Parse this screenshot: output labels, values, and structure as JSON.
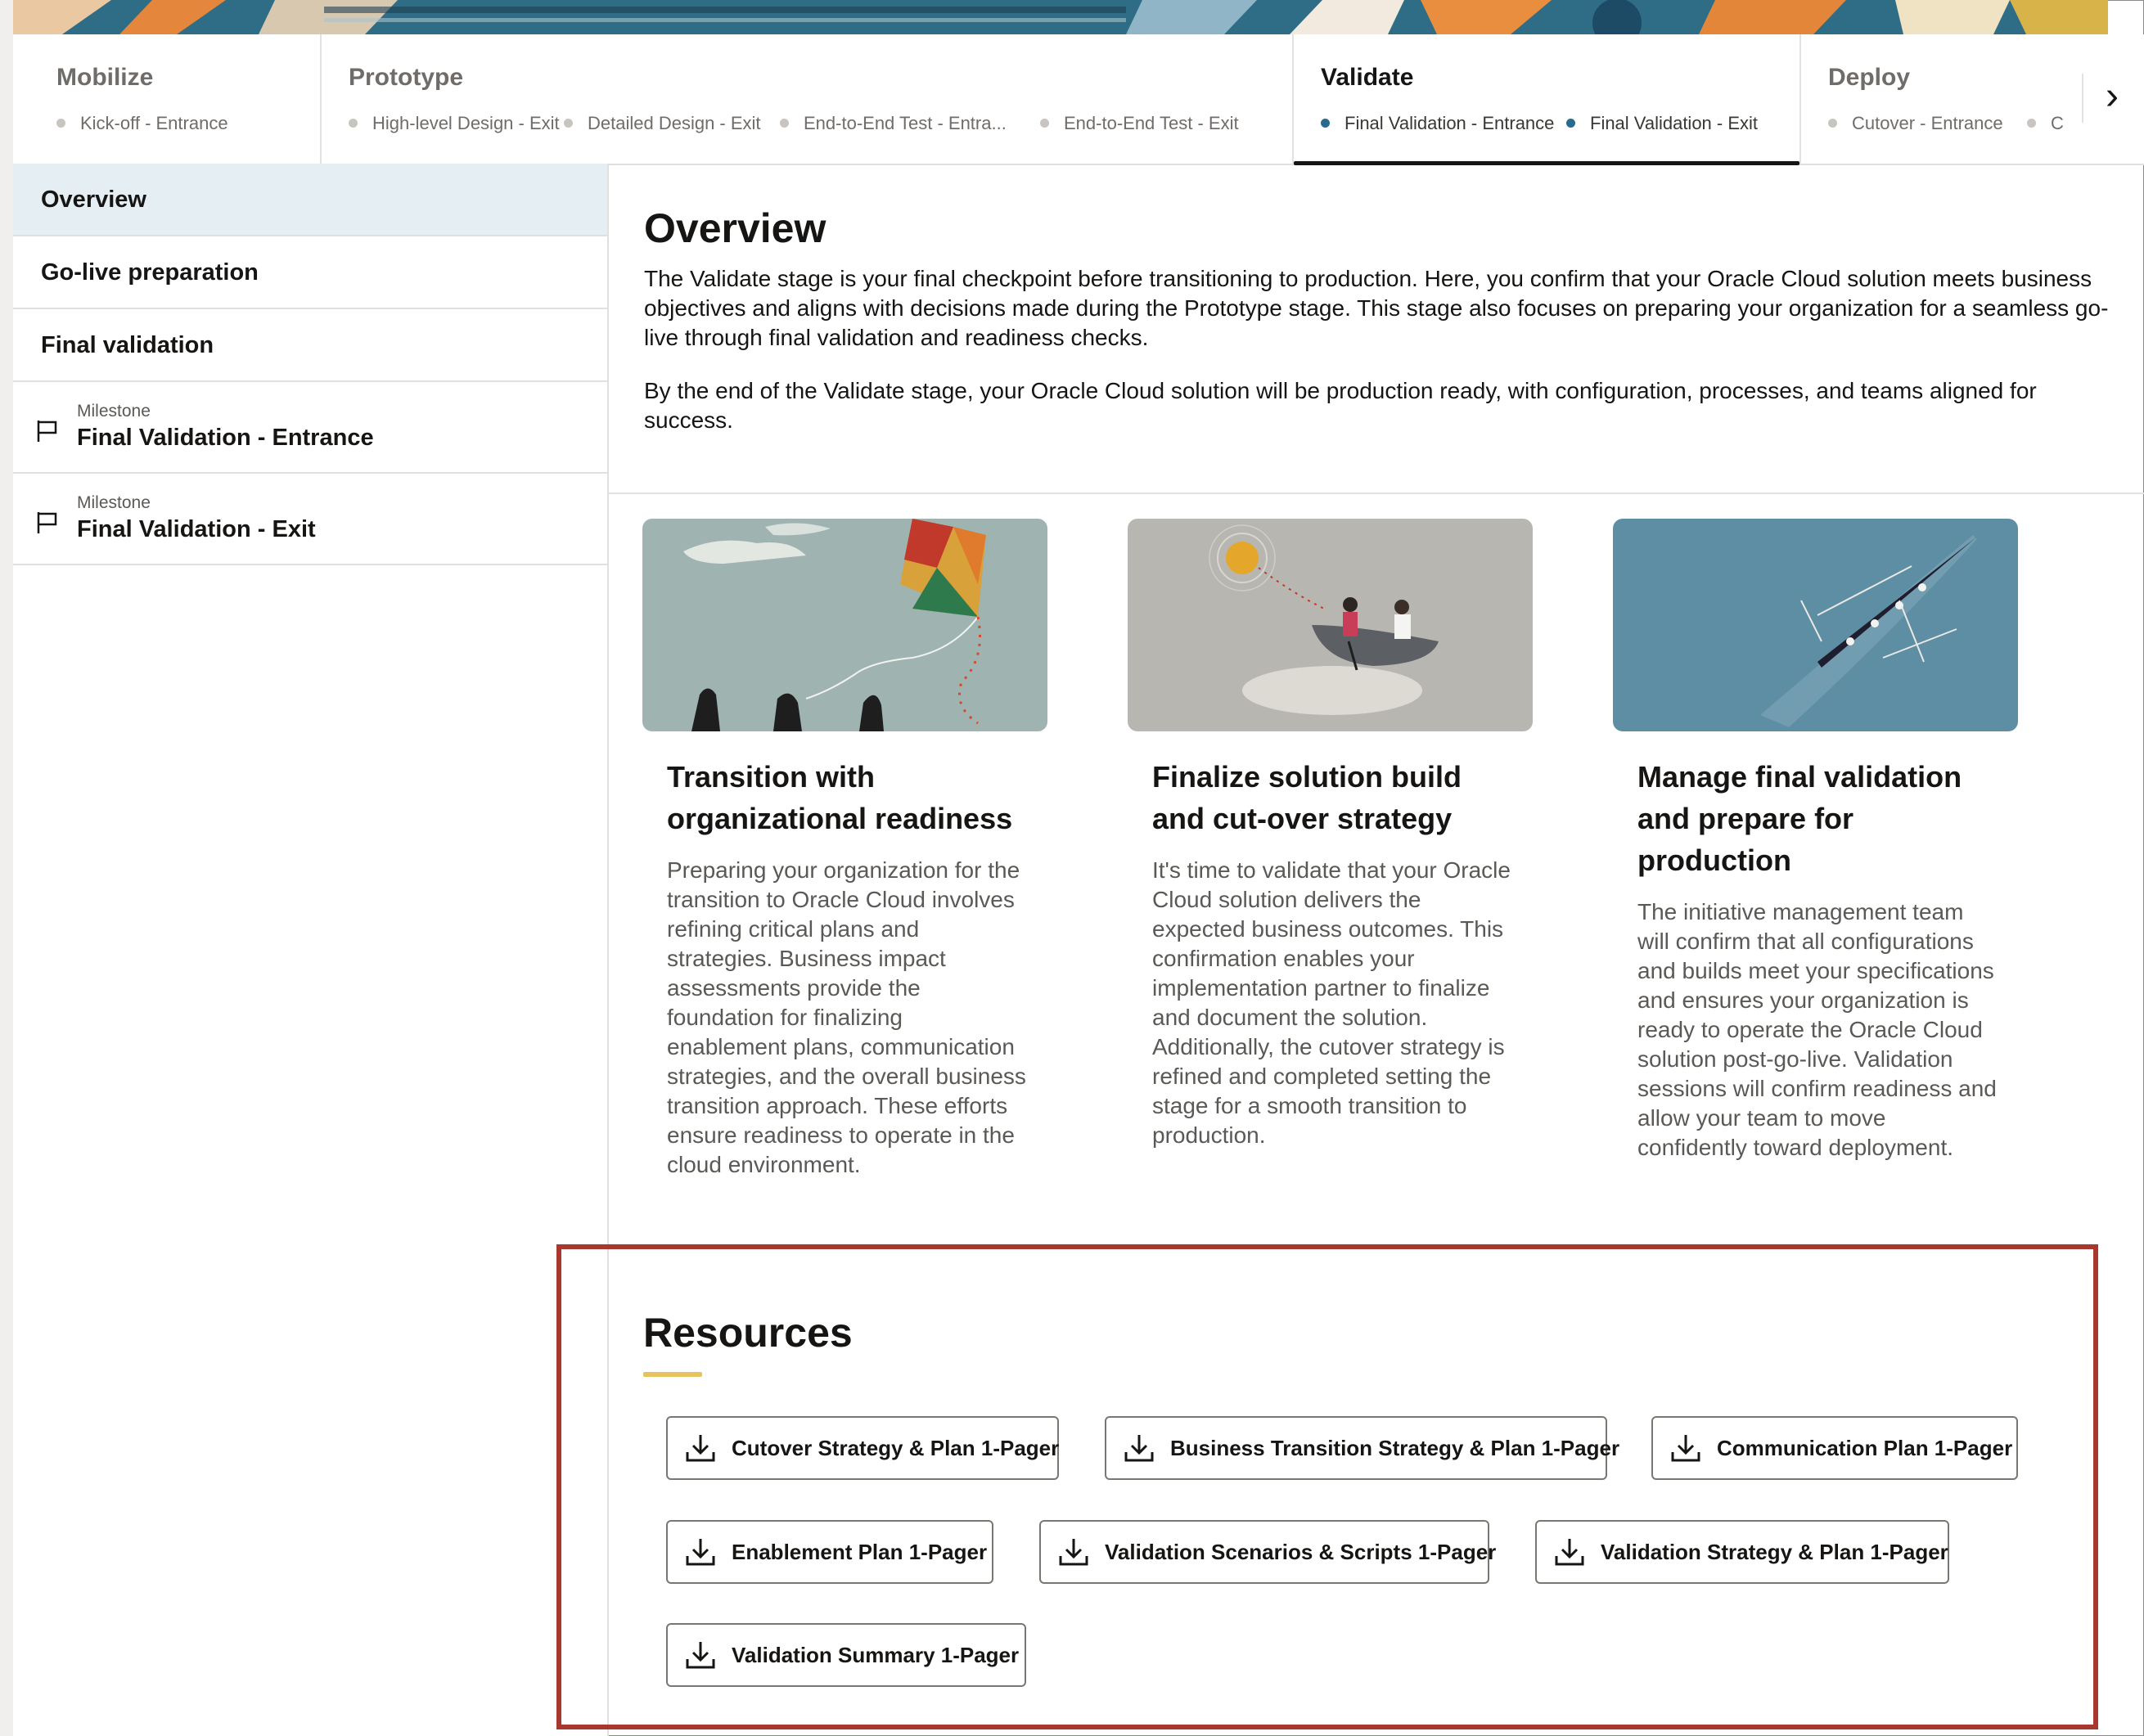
{
  "stages": [
    {
      "title": "Mobilize",
      "milestones": [
        "Kick-off - Entrance"
      ],
      "active": false
    },
    {
      "title": "Prototype",
      "milestones": [
        "High-level Design - Exit",
        "Detailed Design - Exit",
        "End-to-End Test - Entra...",
        "End-to-End Test - Exit"
      ],
      "active": false
    },
    {
      "title": "Validate",
      "milestones": [
        "Final Validation - Entrance",
        "Final Validation - Exit"
      ],
      "active": true
    },
    {
      "title": "Deploy",
      "milestones": [
        "Cutover - Entrance",
        "C"
      ],
      "active": false
    }
  ],
  "nav_next_icon": "chevron-right-icon",
  "sidebar": {
    "items": [
      {
        "label": "Overview",
        "selected": true
      },
      {
        "label": "Go-live preparation"
      },
      {
        "label": "Final validation"
      }
    ],
    "milestones": [
      {
        "kicker": "Milestone",
        "label": "Final Validation - Entrance",
        "icon": "flag-icon"
      },
      {
        "kicker": "Milestone",
        "label": "Final Validation - Exit",
        "icon": "flag-icon"
      }
    ]
  },
  "overview": {
    "title": "Overview",
    "paragraphs": [
      "The Validate stage is your final checkpoint before transitioning to production. Here, you confirm that your Oracle Cloud solution meets business objectives and aligns with decisions made during the Prototype stage. This stage also focuses on preparing your organization for a seamless go-live through final validation and readiness checks.",
      "By the end of the Validate stage, your Oracle Cloud solution will be production ready, with configuration, processes, and teams aligned for success."
    ]
  },
  "cards": [
    {
      "title": "Transition with organizational readiness",
      "text": "Preparing your organization for the transition to Oracle Cloud involves refining critical plans and strategies. Business impact assessments provide the foundation for finalizing enablement plans, communication strategies, and the overall business transition approach. These efforts ensure readiness to operate in the cloud environment."
    },
    {
      "title": "Finalize solution build and cut-over strategy",
      "text": "It's time to validate that your Oracle Cloud solution delivers the expected business outcomes. This confirmation enables your implementation partner to finalize and document the solution. Additionally, the cutover strategy is refined and completed setting the stage for a smooth transition to production."
    },
    {
      "title": "Manage final validation and prepare for production",
      "text": "The initiative management team will confirm that all configurations and builds meet your specifications and ensures your organization is ready to operate the Oracle Cloud solution post-go-live. Validation sessions will confirm readiness and allow your team to move confidently toward deployment."
    }
  ],
  "resources": {
    "title": "Resources",
    "buttons": [
      "Cutover Strategy & Plan 1-Pager",
      "Business Transition Strategy & Plan 1-Pager",
      "Communication Plan 1-Pager",
      "Enablement Plan 1-Pager",
      "Validation Scenarios & Scripts 1-Pager",
      "Validation Strategy & Plan 1-Pager",
      "Validation Summary 1-Pager"
    ],
    "button_icon": "download-icon"
  },
  "colors": {
    "accent_dot": "#2b6a8f",
    "highlight_box": "#a8382e",
    "underline": "#e6c35c",
    "selected_bg": "#e4eef3"
  }
}
